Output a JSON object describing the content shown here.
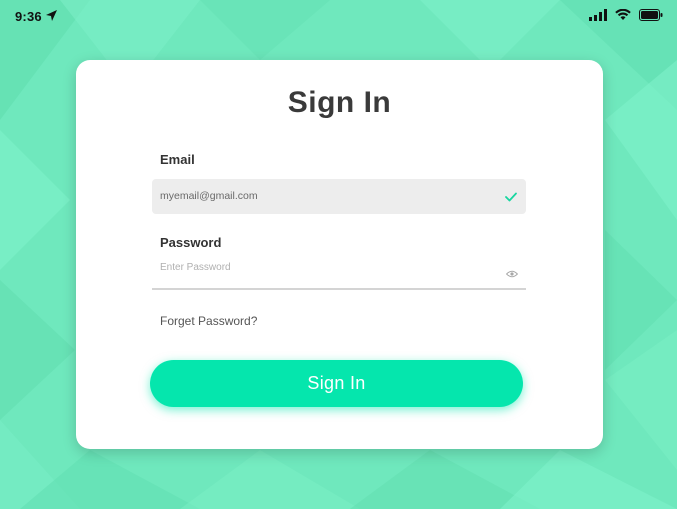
{
  "status_bar": {
    "time": "9:36"
  },
  "form": {
    "title": "Sign In",
    "email_label": "Email",
    "email_value": "myemail@gmail.com",
    "password_label": "Password",
    "password_placeholder": "Enter Password",
    "forgot_label": "Forget Password?",
    "submit_label": "Sign In"
  },
  "colors": {
    "background": "#6fe8bd",
    "accent": "#05e6ad",
    "card": "#ffffff"
  },
  "icons": [
    "location-arrow-icon",
    "signal-bars-icon",
    "wifi-icon",
    "battery-icon",
    "check-icon",
    "eye-icon"
  ]
}
